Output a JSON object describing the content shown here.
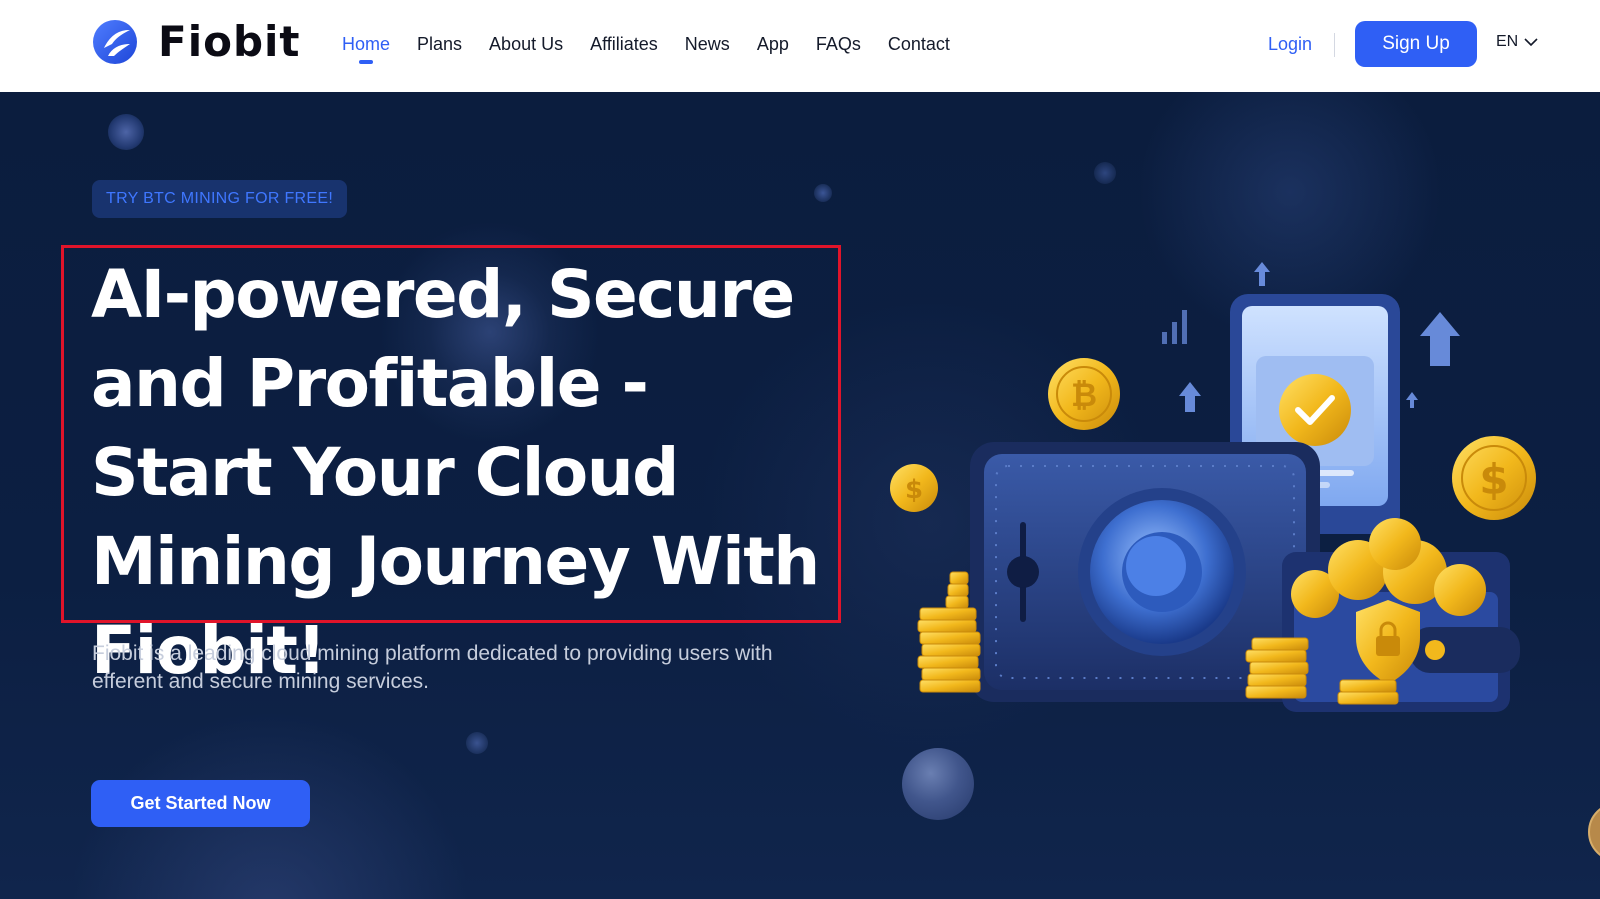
{
  "header": {
    "logo_text": "Fiobit",
    "logo_icon": "fiobit-logo-icon",
    "nav": [
      {
        "label": "Home",
        "active": true
      },
      {
        "label": "Plans",
        "active": false
      },
      {
        "label": "About Us",
        "active": false
      },
      {
        "label": "Affiliates",
        "active": false
      },
      {
        "label": "News",
        "active": false
      },
      {
        "label": "App",
        "active": false
      },
      {
        "label": "FAQs",
        "active": false
      },
      {
        "label": "Contact",
        "active": false
      }
    ],
    "login_label": "Login",
    "signup_label": "Sign Up",
    "language": "EN"
  },
  "hero": {
    "badge": "TRY BTC MINING FOR FREE!",
    "headline": "AI-powered, Secure and Profitable - Start Your Cloud Mining Journey With Fiobit!",
    "subtext": "Fiobit is a leading cloud mining platform dedicated to providing users with efferent and secure mining services.",
    "cta_label": "Get Started Now"
  },
  "colors": {
    "accent": "#2f5ff5",
    "hero_bg": "#0b1d3e",
    "highlight_border": "#e0142a",
    "coin_gold": "#f2b81c"
  }
}
